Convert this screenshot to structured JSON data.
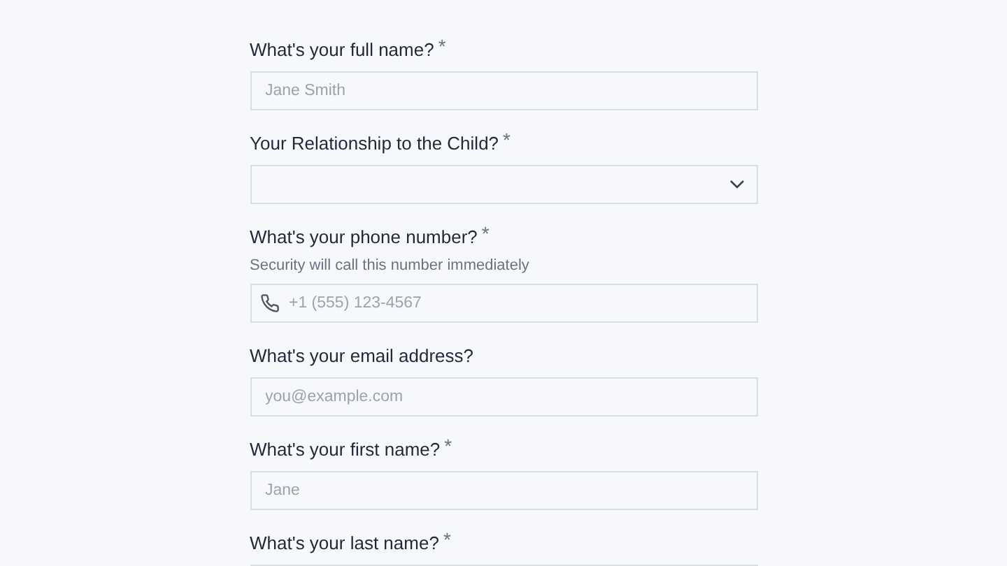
{
  "fields": [
    {
      "kind": "text",
      "label": "What's your full name?",
      "required_mark": "*",
      "placeholder": "Jane Smith"
    },
    {
      "kind": "select",
      "label": "Your Relationship to the Child?",
      "required_mark": "*"
    },
    {
      "kind": "phone",
      "label": "What's your phone number?",
      "required_mark": "*",
      "hint": "Security will call this number immediately",
      "placeholder": "+1 (555) 123-4567"
    },
    {
      "kind": "text",
      "label": "What's your email address?",
      "placeholder": "you@example.com"
    },
    {
      "kind": "text",
      "label": "What's your first name?",
      "required_mark": "*",
      "placeholder": "Jane"
    },
    {
      "kind": "text",
      "label": "What's your last name?",
      "required_mark": "*"
    }
  ]
}
